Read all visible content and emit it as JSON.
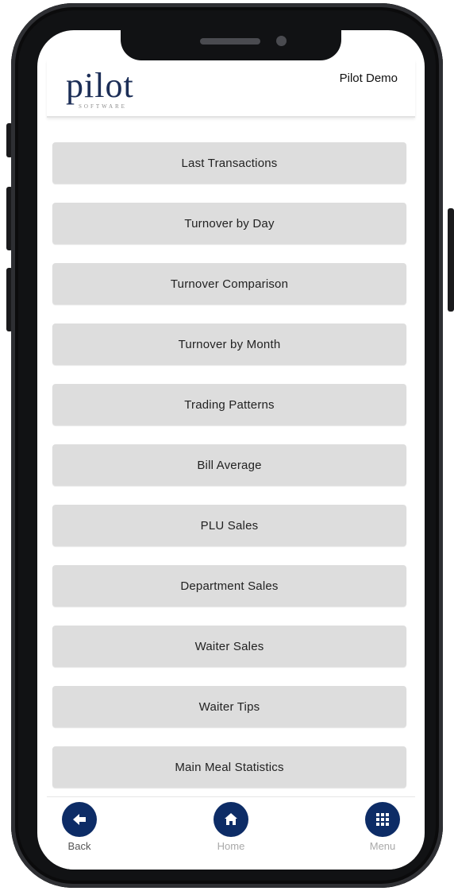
{
  "header": {
    "logo_word": "pilot",
    "logo_sub": "SOFTWARE",
    "company": "Pilot Demo"
  },
  "menu": {
    "items": [
      {
        "label": "Last Transactions"
      },
      {
        "label": "Turnover by Day"
      },
      {
        "label": "Turnover Comparison"
      },
      {
        "label": "Turnover by Month"
      },
      {
        "label": "Trading Patterns"
      },
      {
        "label": "Bill Average"
      },
      {
        "label": "PLU Sales"
      },
      {
        "label": "Department Sales"
      },
      {
        "label": "Waiter Sales"
      },
      {
        "label": "Waiter Tips"
      },
      {
        "label": "Main Meal Statistics"
      }
    ]
  },
  "nav": {
    "back": {
      "label": "Back",
      "icon": "arrow-left-icon"
    },
    "home": {
      "label": "Home",
      "icon": "home-icon"
    },
    "menu": {
      "label": "Menu",
      "icon": "grid-icon"
    }
  },
  "colors": {
    "brand_navy": "#0d2c66",
    "item_bg": "#dddddd"
  }
}
